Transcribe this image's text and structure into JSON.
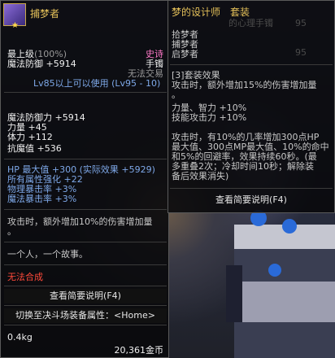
{
  "item": {
    "name": "捕梦者",
    "level_label": "最上级",
    "level_pct": "(100%)",
    "rarity": "史诗",
    "defense_stat": "魔法防御 +5914",
    "slot": "手镯",
    "trade": "无法交易",
    "requirement": "Lv85以上可以使用 (Lv95 - 10)",
    "stats": [
      "魔法防御力 +5914",
      "力量 +45",
      "体力 +112",
      "抗魔值 +536"
    ],
    "bonus_stats": [
      "HP 最大值 +300 (实际效果 +5929)",
      "所有属性强化 +22",
      "物理暴击率 +3%",
      "魔法暴击率 +3%"
    ],
    "effect_lines": [
      "攻击时，额外增加10%的伤害增加量",
      "。"
    ],
    "flavor": "一个人，一个故事。",
    "cannot_combine": "无法合成",
    "brief_btn": "查看简要说明(F4)",
    "switch_btn": "切换至决斗场装备属性：<Home>",
    "weight": "0.4kg",
    "price": "20,361金币"
  },
  "set": {
    "title": "梦的设计师　套装",
    "members": [
      "拾梦者",
      "捕梦者",
      "启梦者"
    ],
    "bg_ghost": [
      "的心理手镯",
      "95",
      "95"
    ],
    "effect_header": "[3]套装效果",
    "effect_lines1": [
      "攻击时，额外增加15%的伤害增加量",
      "。"
    ],
    "effect_lines2": [
      "力量、智力 +10%",
      "技能攻击力 +10%"
    ],
    "effect_lines3": [
      "攻击时，有10%的几率增加300点HP",
      "最大值、300点MP最大值、10%的命中",
      "和5%的回避率，效果持续60秒。(最",
      "多重叠2次；冷却时间10秒；解除装",
      "备后效果消失)"
    ],
    "brief_btn": "查看简要说明(F4)"
  },
  "colors": {
    "gold": "#e6c25a",
    "blue": "#68a8ff",
    "pink": "#ff7ac8",
    "red": "#ff4a3a"
  }
}
